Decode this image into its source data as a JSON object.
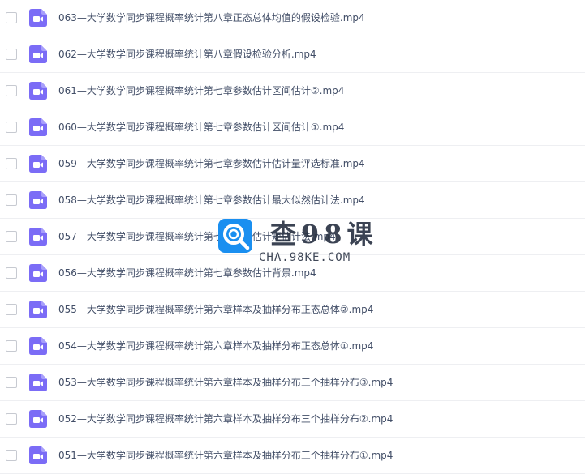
{
  "files": [
    {
      "name": "063—大学数学同步课程概率统计第八章正态总体均值的假设检验.mp4"
    },
    {
      "name": "062—大学数学同步课程概率统计第八章假设检验分析.mp4"
    },
    {
      "name": "061—大学数学同步课程概率统计第七章参数估计区间估计②.mp4"
    },
    {
      "name": "060—大学数学同步课程概率统计第七章参数估计区间估计①.mp4"
    },
    {
      "name": "059—大学数学同步课程概率统计第七章参数估计估计量评选标准.mp4"
    },
    {
      "name": "058—大学数学同步课程概率统计第七章参数估计最大似然估计法.mp4"
    },
    {
      "name": "057—大学数学同步课程概率统计第七章参数估计矩估计法.mp4"
    },
    {
      "name": "056—大学数学同步课程概率统计第七章参数估计背景.mp4"
    },
    {
      "name": "055—大学数学同步课程概率统计第六章样本及抽样分布正态总体②.mp4"
    },
    {
      "name": "054—大学数学同步课程概率统计第六章样本及抽样分布正态总体①.mp4"
    },
    {
      "name": "053—大学数学同步课程概率统计第六章样本及抽样分布三个抽样分布③.mp4"
    },
    {
      "name": "052—大学数学同步课程概率统计第六章样本及抽样分布三个抽样分布②.mp4"
    },
    {
      "name": "051—大学数学同步课程概率统计第六章样本及抽样分布三个抽样分布①.mp4"
    }
  ],
  "icons": {
    "file_icon": "video-file-icon",
    "checkbox": "checkbox-icon",
    "watermark_logo": "magnifier-logo-icon"
  },
  "colors": {
    "video_icon": "#7b6cf6",
    "text": "#424e67",
    "divider": "#eeeff2",
    "watermark_blue": "#1a8ff0"
  },
  "watermark": {
    "title": "查98课",
    "subtitle": "CHA.98KE.COM"
  }
}
